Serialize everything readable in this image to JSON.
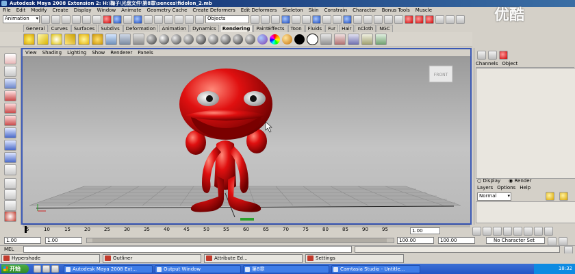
{
  "window": {
    "title": "Autodesk Maya 2008 Extension 2: H:\\鞠子\\光盘文件\\第8章\\sences\\fidolon_2.mb"
  },
  "menu": [
    "File",
    "Edit",
    "Modify",
    "Create",
    "Display",
    "Window",
    "Animate",
    "Geometry Cache",
    "Create Deformers",
    "Edit Deformers",
    "Skeleton",
    "Skin",
    "Constrain",
    "Character",
    "Bonus Tools",
    "Muscle"
  ],
  "status_line": {
    "mode": "Animation",
    "selection_field": "Objects"
  },
  "shelf_tabs": [
    "General",
    "Curves",
    "Surfaces",
    "Subdivs",
    "Deformation",
    "Animation",
    "Dynamics",
    "Rendering",
    "PaintEffects",
    "Toon",
    "Fluids",
    "Fur",
    "Hair",
    "nCloth",
    "NGC"
  ],
  "active_shelf_tab": "Rendering",
  "viewport": {
    "menu": [
      "View",
      "Shading",
      "Lighting",
      "Show",
      "Renderer",
      "Panels"
    ],
    "view_cube_label": "FRONT"
  },
  "channel_box": {
    "menu": [
      "Channels",
      "Object"
    ]
  },
  "layer_editor": {
    "radio_display": "Display",
    "radio_render": "Render",
    "menu": [
      "Layers",
      "Options",
      "Help"
    ],
    "blend_mode": "Normal"
  },
  "timeline": {
    "ticks": [
      "5",
      "10",
      "15",
      "20",
      "25",
      "30",
      "35",
      "40",
      "45",
      "50",
      "55",
      "60",
      "65",
      "70",
      "75",
      "80",
      "85",
      "90",
      "95"
    ],
    "current_frame": "1.00"
  },
  "range_slider": {
    "start_time": "1.00",
    "playback_start": "1.00",
    "playback_end": "100.00",
    "end_time": "100.00",
    "character_set": "No Character Set"
  },
  "command_line": {
    "label": "MEL"
  },
  "minimized_windows": [
    "Hypershade",
    "Outliner",
    "Attribute Ed...",
    "Settings"
  ],
  "taskbar": {
    "start_label": "开始",
    "items": [
      "Autodesk Maya 2008 Ext...",
      "Output Window",
      "第8章",
      "Camtasia Studio - Untitle..."
    ],
    "clock": "18:32"
  },
  "watermark": "优酷"
}
